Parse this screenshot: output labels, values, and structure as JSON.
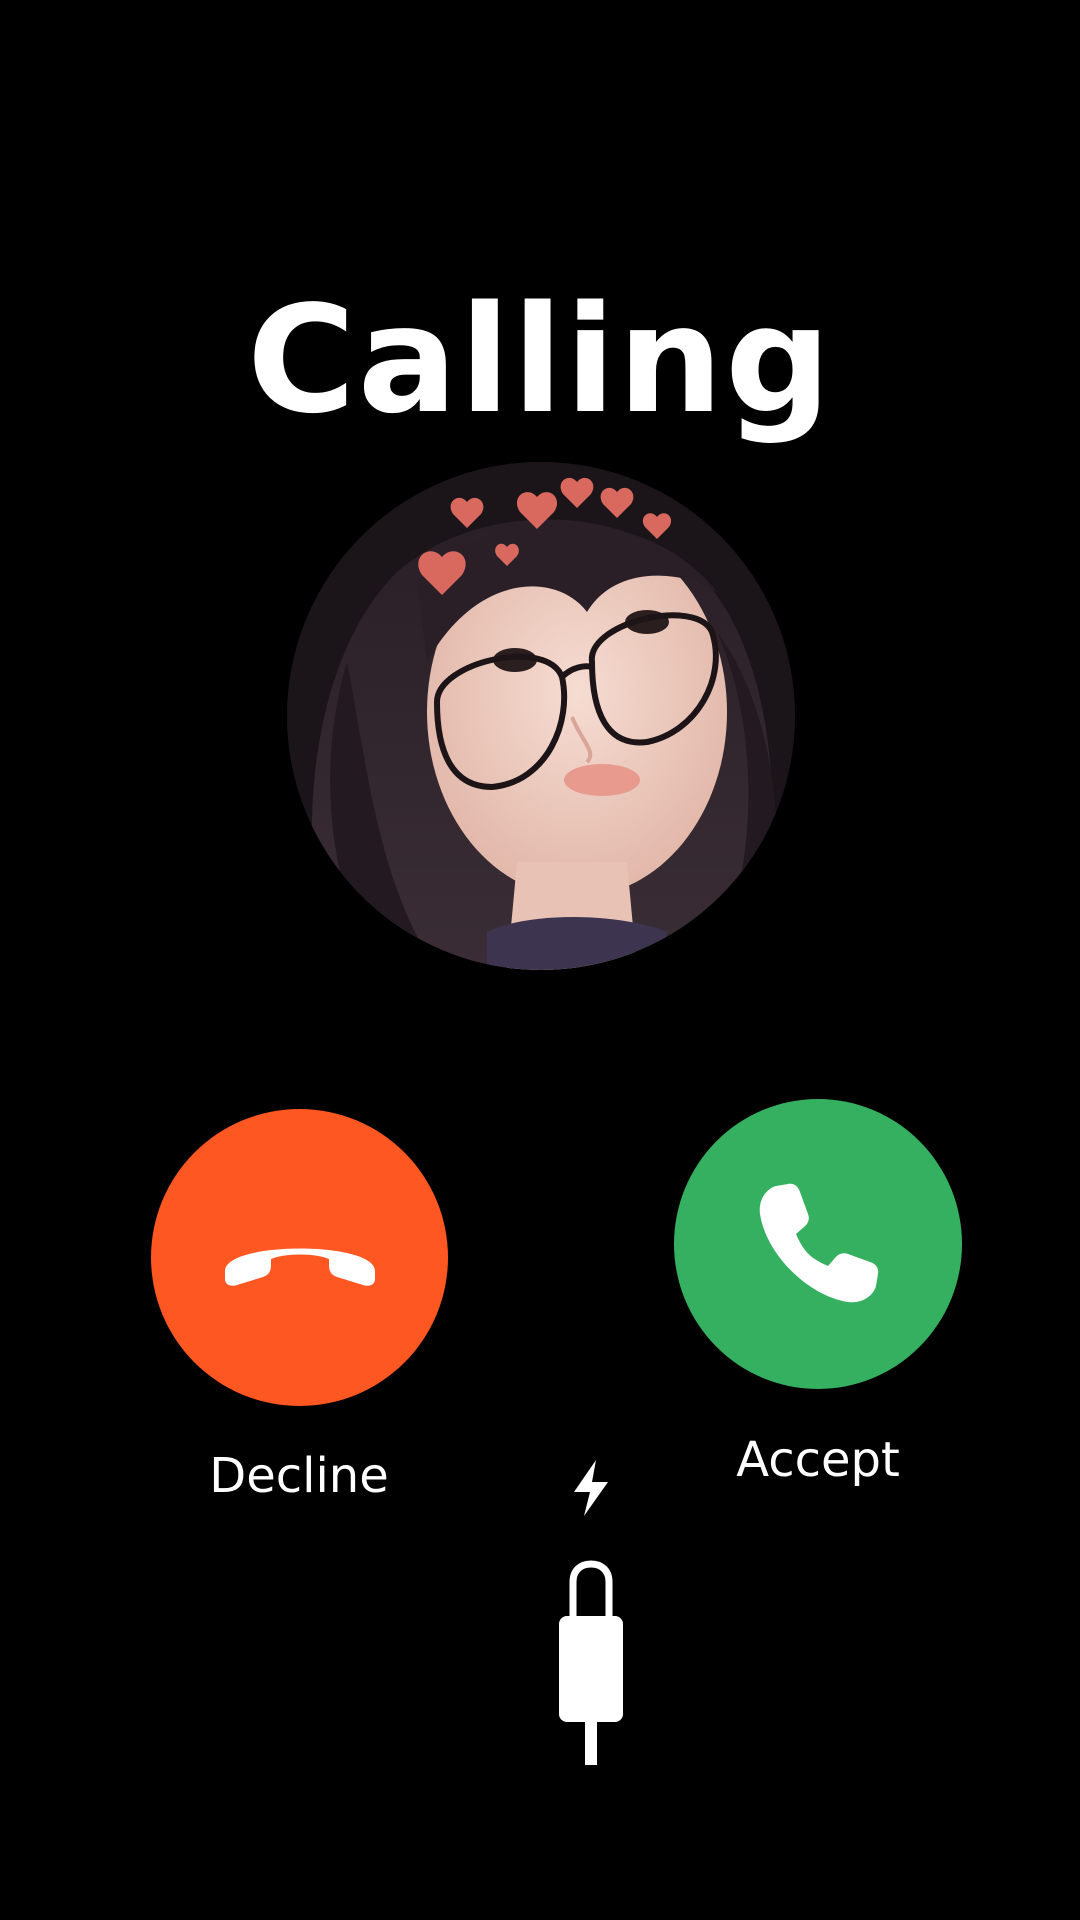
{
  "screen": {
    "title": "Calling"
  },
  "caller": {
    "avatar_icon": "caller-photo"
  },
  "actions": {
    "decline_label": "Decline",
    "accept_label": "Accept",
    "decline_color": "#FF5722",
    "accept_color": "#35B060",
    "decline_icon": "phone-hangup-icon",
    "accept_icon": "phone-icon"
  },
  "charging": {
    "bolt_icon": "lightning-bolt-icon",
    "cable_icon": "charging-cable-icon"
  }
}
